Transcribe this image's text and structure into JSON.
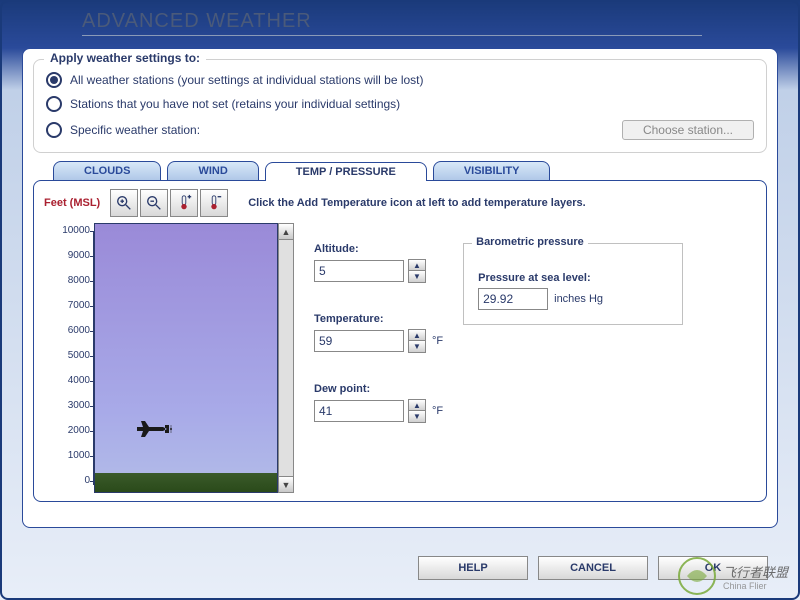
{
  "title": "ADVANCED WEATHER",
  "apply_group": {
    "legend": "Apply weather settings to:",
    "options": [
      "All weather stations (your settings at individual stations will be lost)",
      "Stations that you have not set (retains your individual settings)",
      "Specific weather station:"
    ],
    "choose_button": "Choose station..."
  },
  "tabs": [
    "CLOUDS",
    "WIND",
    "TEMP / PRESSURE",
    "VISIBILITY"
  ],
  "active_tab": 2,
  "axis_label": "Feet (MSL)",
  "axis_ticks": [
    "10000",
    "9000",
    "8000",
    "7000",
    "6000",
    "5000",
    "4000",
    "3000",
    "2000",
    "1000",
    "0"
  ],
  "instruction": "Click the Add Temperature icon at left to add temperature layers.",
  "fields": {
    "altitude": {
      "label": "Altitude:",
      "value": "5"
    },
    "temperature": {
      "label": "Temperature:",
      "value": "59",
      "unit": "°F"
    },
    "dewpoint": {
      "label": "Dew point:",
      "value": "41",
      "unit": "°F"
    }
  },
  "pressure": {
    "group_label": "Barometric pressure",
    "label": "Pressure at sea level:",
    "value": "29.92",
    "unit": "inches Hg"
  },
  "buttons": {
    "help": "HELP",
    "cancel": "CANCEL",
    "ok": "OK"
  },
  "watermark": {
    "main": "飞行者联盟",
    "sub": "China Flier"
  }
}
